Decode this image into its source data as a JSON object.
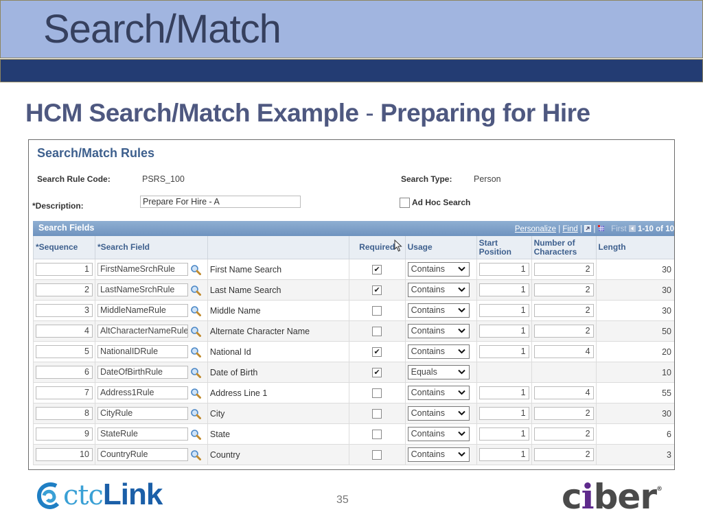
{
  "slide": {
    "title": "Search/Match",
    "subtitle_left": "HCM Search/Match Example",
    "subtitle_sep": "-",
    "subtitle_right": "Preparing for Hire",
    "page_number": "35",
    "colors": {
      "title_band": "#a1b5e0",
      "navy_band": "#233c73",
      "subtitle": "#4e5880"
    }
  },
  "form": {
    "page_title": "Search/Match Rules",
    "search_rule_code_label": "Search Rule Code:",
    "search_rule_code_value": "PSRS_100",
    "search_type_label": "Search Type:",
    "search_type_value": "Person",
    "description_label": "*Description:",
    "description_value": "Prepare For Hire - A",
    "adhoc_label": "Ad Hoc Search",
    "adhoc_checked": false
  },
  "grid": {
    "title": "Search Fields",
    "nav": {
      "personalize": "Personalize",
      "sep": "|",
      "find": "Find",
      "first": "First",
      "count": "1-10 of 10"
    },
    "headers": {
      "sequence": "*Sequence",
      "search_field": "*Search Field",
      "description": "",
      "required": "Required",
      "usage": "Usage",
      "start_position_1": "Start",
      "start_position_2": "Position",
      "num_chars_1": "Number of",
      "num_chars_2": "Characters",
      "length": "Length"
    },
    "rows": [
      {
        "seq": "1",
        "field": "FirstNameSrchRule",
        "desc": "First Name Search",
        "required": "✔",
        "usage": "Contains",
        "start": "1",
        "chars": "2",
        "length": "30"
      },
      {
        "seq": "2",
        "field": "LastNameSrchRule",
        "desc": "Last Name Search",
        "required": "✔",
        "usage": "Contains",
        "start": "1",
        "chars": "2",
        "length": "30"
      },
      {
        "seq": "3",
        "field": "MiddleNameRule",
        "desc": "Middle Name",
        "required": "",
        "usage": "Contains",
        "start": "1",
        "chars": "2",
        "length": "30"
      },
      {
        "seq": "4",
        "field": "AltCharacterNameRule",
        "desc": "Alternate Character Name",
        "required": "",
        "usage": "Contains",
        "start": "1",
        "chars": "2",
        "length": "50"
      },
      {
        "seq": "5",
        "field": "NationalIDRule",
        "desc": "National Id",
        "required": "✔",
        "usage": "Contains",
        "start": "1",
        "chars": "4",
        "length": "20"
      },
      {
        "seq": "6",
        "field": "DateOfBirthRule",
        "desc": "Date of Birth",
        "required": "✔",
        "usage": "Equals",
        "start": "",
        "chars": "",
        "length": "10"
      },
      {
        "seq": "7",
        "field": "Address1Rule",
        "desc": "Address Line 1",
        "required": "",
        "usage": "Contains",
        "start": "1",
        "chars": "4",
        "length": "55"
      },
      {
        "seq": "8",
        "field": "CityRule",
        "desc": "City",
        "required": "",
        "usage": "Contains",
        "start": "1",
        "chars": "2",
        "length": "30"
      },
      {
        "seq": "9",
        "field": "StateRule",
        "desc": "State",
        "required": "",
        "usage": "Contains",
        "start": "1",
        "chars": "2",
        "length": "6"
      },
      {
        "seq": "10",
        "field": "CountryRule",
        "desc": "Country",
        "required": "",
        "usage": "Contains",
        "start": "1",
        "chars": "2",
        "length": "3"
      }
    ]
  },
  "logos": {
    "left_ctc": "ctc",
    "left_link": "Link",
    "right_c": "c",
    "right_i": "i",
    "right_ber": "ber",
    "right_reg": "®"
  }
}
